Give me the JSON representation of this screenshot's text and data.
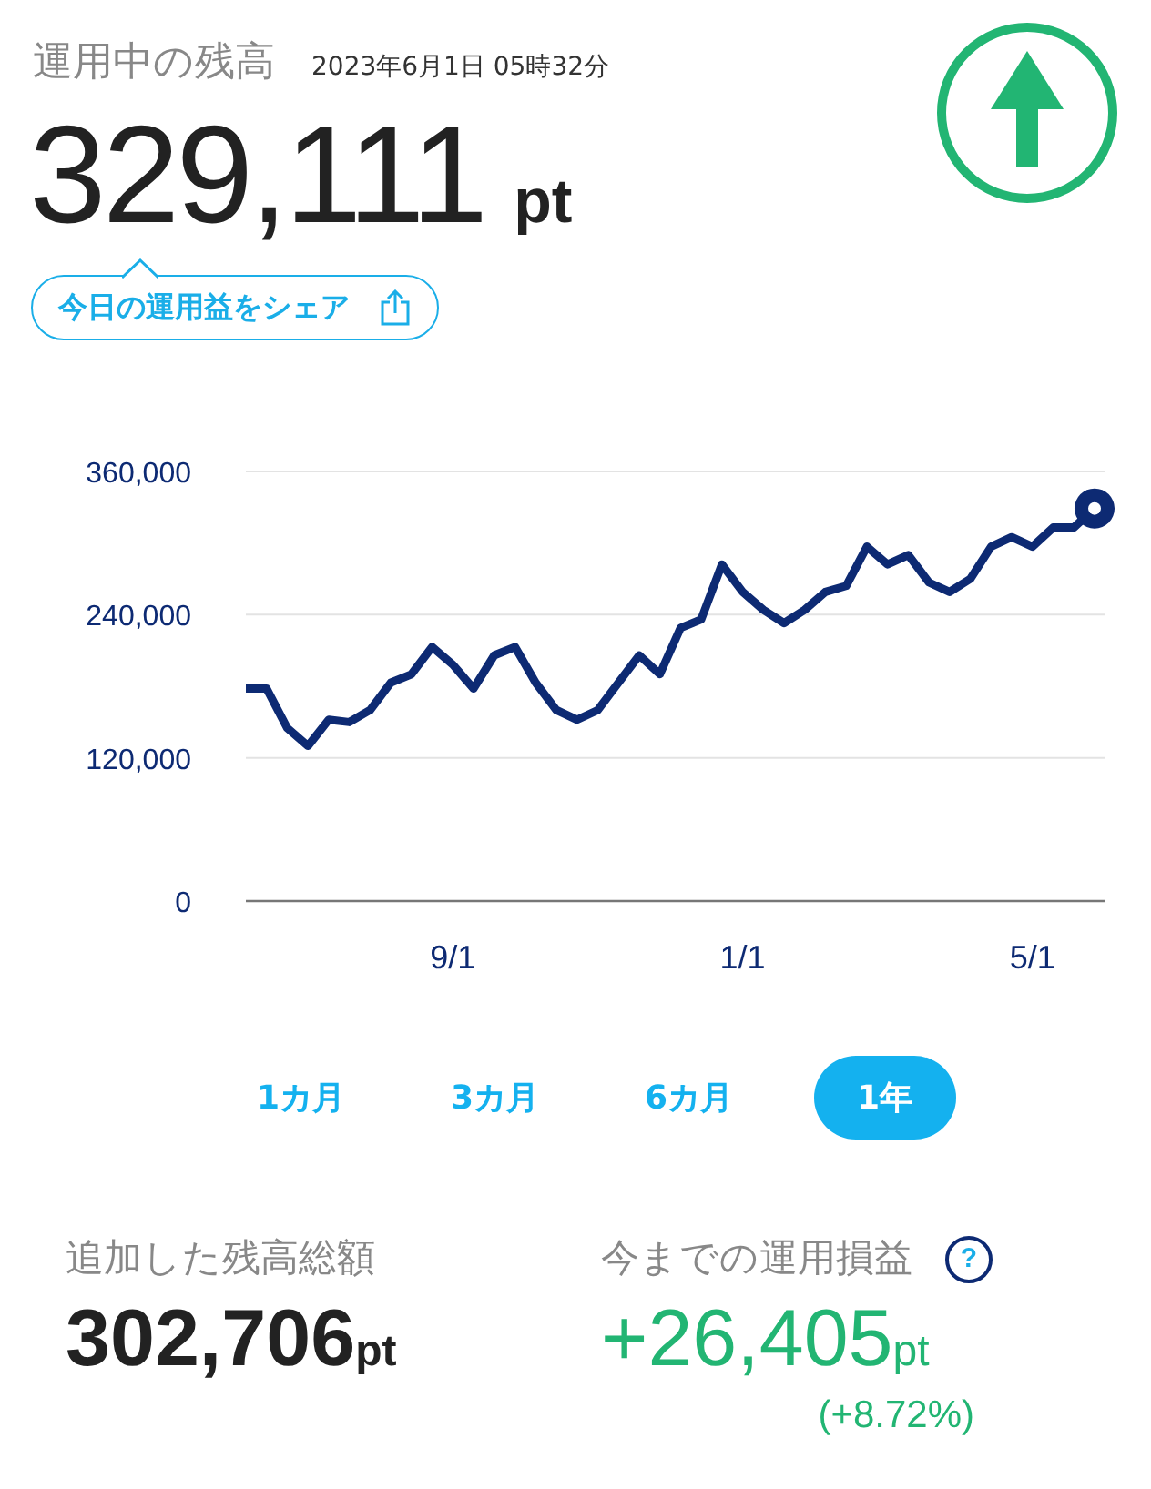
{
  "header": {
    "title": "運用中の残高",
    "timestamp": "2023年6月1日 05時32分"
  },
  "balance": {
    "value": "329,111",
    "unit": "pt"
  },
  "share_button": {
    "label": "今日の運用益をシェア"
  },
  "chart": {
    "chart_data": {
      "type": "line",
      "ylim": [
        0,
        360000
      ],
      "categories": [
        null,
        null,
        null,
        null,
        null,
        null,
        null,
        null,
        null,
        null,
        "9/1",
        null,
        null,
        null,
        null,
        null,
        null,
        null,
        null,
        null,
        null,
        null,
        null,
        null,
        "1/1",
        null,
        null,
        null,
        null,
        null,
        null,
        null,
        null,
        null,
        null,
        null,
        null,
        null,
        "5/1",
        null,
        null,
        null
      ],
      "yticks": [
        {
          "value": 0,
          "label": "0"
        },
        {
          "value": 120000,
          "label": "120,000"
        },
        {
          "value": 240000,
          "label": "240,000"
        },
        {
          "value": 360000,
          "label": "360,000"
        }
      ],
      "series": [
        {
          "color": "#0d2a73",
          "values": [
            178000,
            178000,
            145000,
            130000,
            152000,
            150000,
            160000,
            183000,
            190000,
            213000,
            198000,
            178000,
            206000,
            213000,
            183000,
            160000,
            152000,
            160000,
            183000,
            206000,
            190000,
            229000,
            236000,
            282000,
            259000,
            244000,
            233000,
            244000,
            259000,
            264000,
            297000,
            282000,
            290000,
            267000,
            259000,
            270000,
            297000,
            305000,
            297000,
            313000,
            313000,
            329000
          ]
        }
      ]
    }
  },
  "periods": [
    {
      "label": "1カ月",
      "selected": false
    },
    {
      "label": "3カ月",
      "selected": false
    },
    {
      "label": "6カ月",
      "selected": false
    },
    {
      "label": "1年",
      "selected": true
    }
  ],
  "summary": {
    "added": {
      "label": "追加した残高総額",
      "value": "302,706",
      "unit": "pt"
    },
    "profit": {
      "label": "今までの運用損益",
      "help": "?",
      "value": "+26,405",
      "unit": "pt",
      "percent": "(+8.72%)"
    }
  }
}
